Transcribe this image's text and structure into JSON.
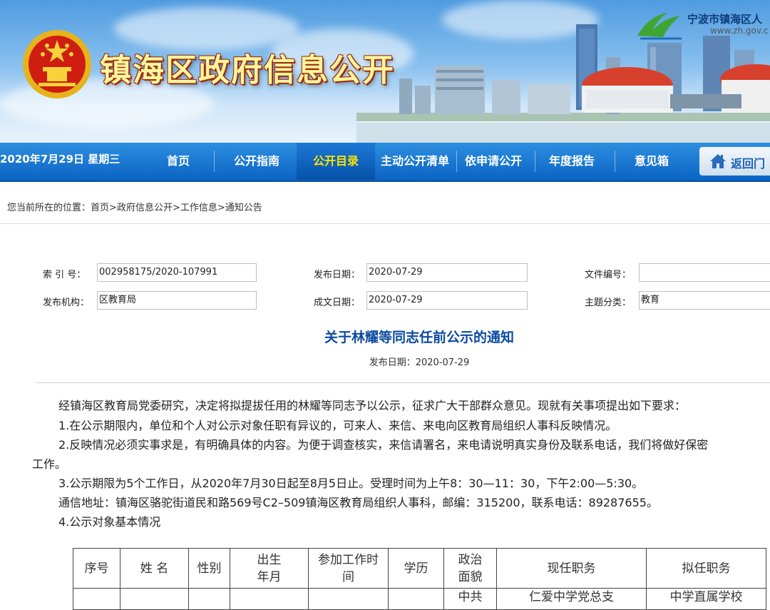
{
  "header": {
    "site_title": "镇海区政府信息公开",
    "top_logo_name": "宁波市镇海区人",
    "top_logo_url": "www.zh.gov.c",
    "colors": {
      "title_text": "#fff59a",
      "title_outline": "#9b2a12",
      "sky": "#4f9be0"
    }
  },
  "nav": {
    "date": "2020年7月29日 星期三",
    "items": [
      "首页",
      "公开指南",
      "公开目录",
      "主动公开清单",
      "依申请公开",
      "年度报告",
      "意见箱"
    ],
    "active_item": "公开目录",
    "back_label": "返回门",
    "colors": {
      "bar": "#0a63c3",
      "active_text": "#ffe400"
    }
  },
  "breadcrumb": {
    "prefix": "您当前所在的位置：",
    "items": [
      "首页",
      "政府信息公开",
      "工作信息",
      "通知公告"
    ],
    "separator": ">"
  },
  "meta": {
    "index_label": "索 引 号：",
    "index_value": "002958175/2020-107991",
    "publish_date_label": "发布日期：",
    "publish_date_value": "2020-07-29",
    "doc_no_label": "文件编号：",
    "doc_no_value": "",
    "org_label": "发布机构：",
    "org_value": "区教育局",
    "written_date_label": "成文日期：",
    "written_date_value": "2020-07-29",
    "topic_label": "主题分类：",
    "topic_value": "教育"
  },
  "article": {
    "title": "关于林耀等同志任前公示的通知",
    "date_line": "发布日期：2020-07-29",
    "paragraphs": [
      "经镇海区教育局党委研究，决定将拟提拔任用的林耀等同志予以公示，征求广大干部群众意见。现就有关事项提出如下要求：",
      "1.在公示期限内，单位和个人对公示对象任职有异议的，可来人、来信、来电向区教育局组织人事科反映情况。",
      "2.反映情况必须实事求是，有明确具体的内容。为便于调查核实，来信请署名，来电请说明真实身份及联系电话，我们将做好保密",
      "工作。",
      "3.公示期限为5个工作日，从2020年7月30日起至8月5日止。受理时间为上午8：30—11：30，下午2:00—5:30。",
      "通信地址：镇海区骆驼街道民和路569号C2–509镇海区教育局组织人事科，邮编：315200，联系电话：89287655。",
      "4.公示对象基本情况"
    ]
  },
  "table": {
    "headers": [
      [
        "序号"
      ],
      [
        "姓 名"
      ],
      [
        "性别"
      ],
      [
        "出生",
        "年月"
      ],
      [
        "参加工作时",
        "间"
      ],
      [
        "学历"
      ],
      [
        "政治",
        "面貌"
      ],
      [
        "现任职务"
      ],
      [
        "拟任职务"
      ]
    ],
    "first_row": [
      "",
      "",
      "",
      "",
      "",
      "",
      "中共",
      "仁爱中学党总支",
      "中学直属学校"
    ]
  }
}
